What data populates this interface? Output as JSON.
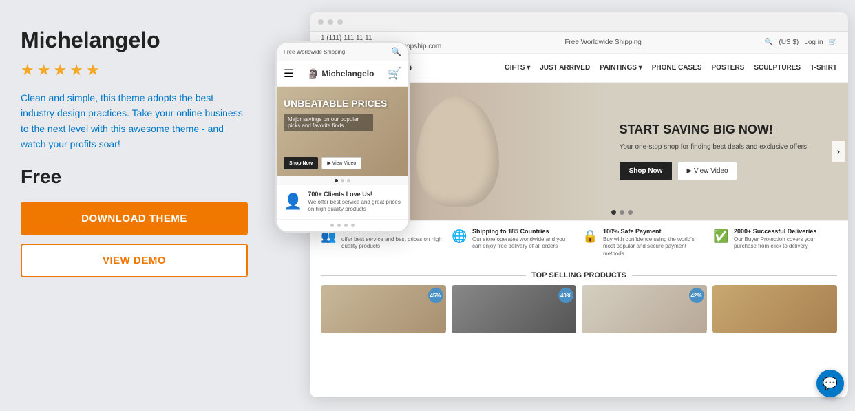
{
  "leftPanel": {
    "title": "Michelangelo",
    "stars": [
      1,
      2,
      3,
      4,
      5
    ],
    "description": "Clean and simple, this theme adopts the best industry design practices. Take your online business to the next level with this awesome theme - and watch your profits soar!",
    "price": "Free",
    "downloadBtn": "DOWNLOAD THEME",
    "demoBtn": "VIEW DEMO"
  },
  "desktopSite": {
    "topbar": {
      "phone": "1 (111) 111 11 11",
      "email": "support@michelangelo.alldropship.com",
      "shipping": "Free Worldwide Shipping",
      "currency": "(US $)",
      "login": "Log in"
    },
    "logo": "Michelangelo",
    "nav": [
      "GIFTS",
      "JUST ARRIVED",
      "PAINTINGS",
      "PHONE CASES",
      "POSTERS",
      "SCULPTURES",
      "T-SHIRT"
    ],
    "hero": {
      "title": "START SAVING BIG NOW!",
      "subtitle": "Your one-stop shop for finding best deals and exclusive offers",
      "shopNow": "Shop Now",
      "viewVideo": "▶ View Video",
      "dots": [
        true,
        false,
        false
      ]
    },
    "features": [
      {
        "icon": "👥",
        "title": "+ Clients Love Us!",
        "desc": "offer best service and best prices on high quality products"
      },
      {
        "icon": "🌐",
        "title": "Shipping to 185 Countries",
        "desc": "Our store operates worldwide and you can enjoy free delivery of all orders"
      },
      {
        "icon": "🔒",
        "title": "100% Safe Payment",
        "desc": "Buy with confidence using the world's most popular and secure payment methods"
      },
      {
        "icon": "✅",
        "title": "2000+ Successful Deliveries",
        "desc": "Our Buyer Protection covers your purchase from click to delivery"
      }
    ],
    "productsTitle": "TOP SELLING PRODUCTS",
    "products": [
      {
        "badge": "45%"
      },
      {
        "badge": "40%"
      },
      {
        "badge": "42%"
      },
      {
        "badge": ""
      }
    ]
  },
  "mobileSite": {
    "topbarText": "Free Worldwide Shipping",
    "logo": "Michelangelo",
    "hero": {
      "title": "UNBEATABLE PRICES",
      "subtitle": "Major savings on our popular picks and favorite finds",
      "shopNow": "Shop Now",
      "viewVideo": "▶ View Video"
    },
    "feature": {
      "title": "700+ Clients Love Us!",
      "desc": "We offer best service and great prices on high quality products"
    },
    "dots": [
      false,
      false,
      false,
      false
    ]
  },
  "chat": {
    "icon": "💬"
  }
}
